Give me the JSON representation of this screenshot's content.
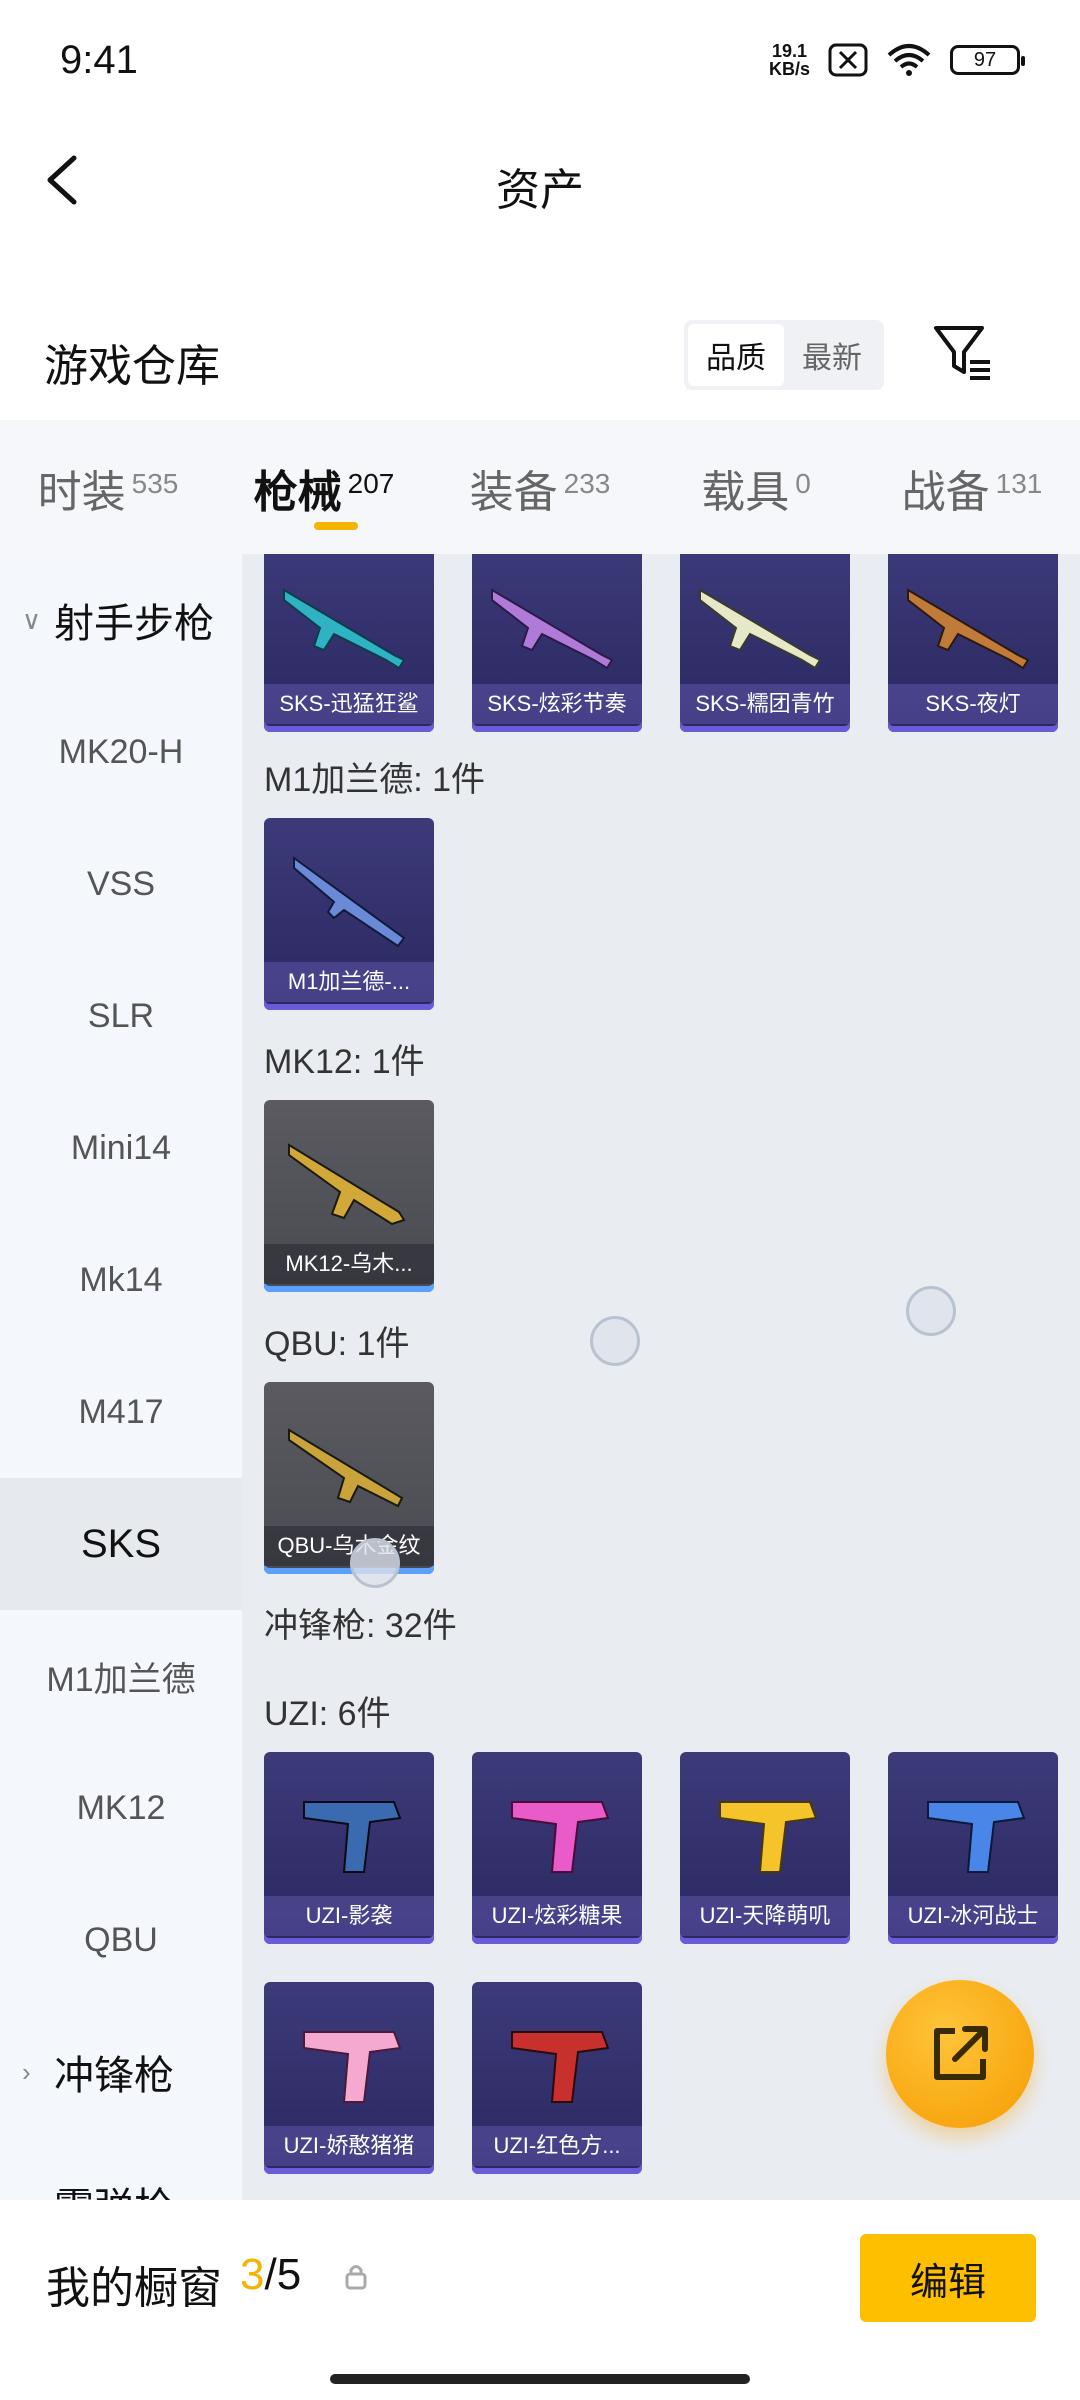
{
  "status_bar": {
    "time": "9:41",
    "net_speed": "19.1",
    "net_unit": "KB/s",
    "battery": "97"
  },
  "header": {
    "title": "资产"
  },
  "section": {
    "title": "游戏仓库",
    "sort_options": [
      "品质",
      "最新"
    ],
    "active_sort": "品质"
  },
  "tabs": [
    {
      "name": "时装",
      "count": "535"
    },
    {
      "name": "枪械",
      "count": "207",
      "active": true
    },
    {
      "name": "装备",
      "count": "233"
    },
    {
      "name": "载具",
      "count": "0"
    },
    {
      "name": "战备",
      "count": "131"
    }
  ],
  "sidebar": {
    "items": [
      {
        "label": "射手步枪",
        "type": "group",
        "expanded": true
      },
      {
        "label": "MK20-H"
      },
      {
        "label": "VSS"
      },
      {
        "label": "SLR"
      },
      {
        "label": "Mini14"
      },
      {
        "label": "Mk14"
      },
      {
        "label": "M417"
      },
      {
        "label": "SKS",
        "active": true
      },
      {
        "label": "M1加兰德"
      },
      {
        "label": "MK12"
      },
      {
        "label": "QBU"
      },
      {
        "label": "冲锋枪",
        "type": "group",
        "expanded": false
      },
      {
        "label": "霰弹枪",
        "type": "group",
        "expanded": false
      }
    ]
  },
  "content": {
    "sks_items": [
      "SKS-迅猛狂鲨",
      "SKS-炫彩节奏",
      "SKS-糯团青竹",
      "SKS-夜灯"
    ],
    "m1_group": "M1加兰德: 1件",
    "m1_items": [
      "M1加兰德-..."
    ],
    "mk12_group": "MK12: 1件",
    "mk12_items": [
      "MK12-乌木..."
    ],
    "qbu_group": "QBU: 1件",
    "qbu_items": [
      "QBU-乌木金纹"
    ],
    "smg_group": "冲锋枪: 32件",
    "uzi_group": "UZI: 6件",
    "uzi_items": [
      "UZI-影袭",
      "UZI-炫彩糖果",
      "UZI-天降萌叽",
      "UZI-冰河战士",
      "UZI-娇憨猪猪",
      "UZI-红色方..."
    ]
  },
  "bottom_bar": {
    "label": "我的橱窗",
    "current": "3",
    "separator": "/",
    "total": "5",
    "edit_label": "编辑"
  },
  "icons": [
    "back-arrow-icon",
    "filter-icon",
    "chevron-down-icon",
    "chevron-right-icon",
    "share-external-icon",
    "lock-icon",
    "wifi-icon",
    "battery-icon"
  ]
}
